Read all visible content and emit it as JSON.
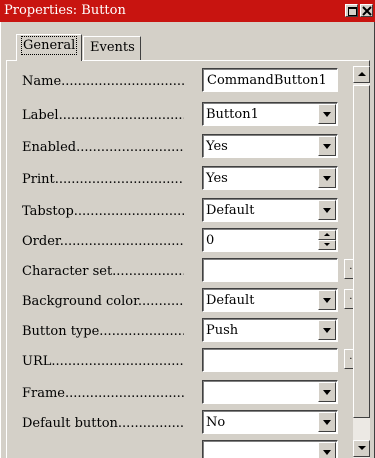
{
  "window": {
    "title": "Properties: Button"
  },
  "tabs": [
    {
      "label": "General",
      "active": true
    },
    {
      "label": "Events",
      "active": false
    }
  ],
  "properties": [
    {
      "label": "Name",
      "dots": "...........................................",
      "value": "CommandButton1",
      "control": "text"
    },
    {
      "label": "Label",
      "dots": "...........................................",
      "value": "Button1",
      "control": "dropdown"
    },
    {
      "label": "Enabled",
      "dots": "...........................................",
      "value": "Yes",
      "control": "dropdown"
    },
    {
      "label": "Print",
      "dots": "...........................................",
      "value": "Yes",
      "control": "dropdown"
    },
    {
      "label": "Tabstop",
      "dots": "...........................................",
      "value": "Default",
      "control": "dropdown"
    },
    {
      "label": "Order",
      "dots": "...........................................",
      "value": "0",
      "control": "spin"
    },
    {
      "label": "Character set",
      "dots": "...........................................",
      "value": "",
      "control": "text-ellipsis"
    },
    {
      "label": "Background color",
      "dots": "...........................................",
      "value": "Default",
      "control": "dropdown-ellipsis"
    },
    {
      "label": "Button type",
      "dots": "...........................................",
      "value": "Push",
      "control": "dropdown"
    },
    {
      "label": "URL",
      "dots": "...........................................",
      "value": "",
      "control": "text-ellipsis"
    },
    {
      "label": "Frame",
      "dots": "...........................................",
      "value": "",
      "control": "dropdown"
    },
    {
      "label": "Default button",
      "dots": "...........................................",
      "value": "No",
      "control": "dropdown"
    }
  ],
  "icons": {
    "maximize": "maximize-icon",
    "close": "close-icon",
    "ellipsis": "..."
  },
  "colors": {
    "titlebar": "#c81410",
    "face": "#d4d0c8"
  }
}
